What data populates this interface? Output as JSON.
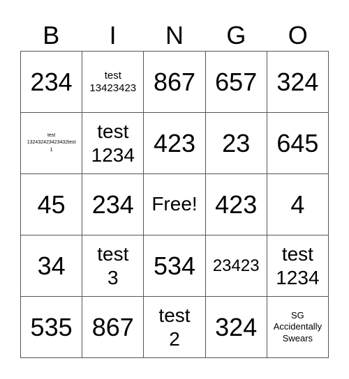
{
  "header": {
    "letters": [
      "B",
      "I",
      "N",
      "G",
      "O"
    ]
  },
  "card": {
    "rows": [
      [
        "234",
        "test 13423423",
        "867",
        "657",
        "324"
      ],
      [
        "test 13243242342343 2test 1",
        "test 1234",
        "423",
        "23",
        "645"
      ],
      [
        "45",
        "234",
        "Free!",
        "423",
        "4"
      ],
      [
        "34",
        "test 3",
        "534",
        "23423",
        "test 1234"
      ],
      [
        "535",
        "867",
        "test 2",
        "324",
        "SG Accidentally Swears"
      ]
    ],
    "cells": {
      "r0c0": "234",
      "r0c1a": "test",
      "r0c1b": "13423423",
      "r0c2": "867",
      "r0c3": "657",
      "r0c4": "324",
      "r1c0a": "test",
      "r1c0b": "132432423423432test",
      "r1c0c": "1",
      "r1c1a": "test",
      "r1c1b": "1234",
      "r1c2": "423",
      "r1c3": "23",
      "r1c4": "645",
      "r2c0": "45",
      "r2c1": "234",
      "r2c2": "Free!",
      "r2c3": "423",
      "r2c4": "4",
      "r3c0": "34",
      "r3c1a": "test",
      "r3c1b": "3",
      "r3c2": "534",
      "r3c3": "23423",
      "r3c4a": "test",
      "r3c4b": "1234",
      "r4c0": "535",
      "r4c1": "867",
      "r4c2a": "test",
      "r4c2b": "2",
      "r4c3": "324",
      "r4c4a": "SG",
      "r4c4b": "Accidentally",
      "r4c4c": "Swears"
    }
  }
}
